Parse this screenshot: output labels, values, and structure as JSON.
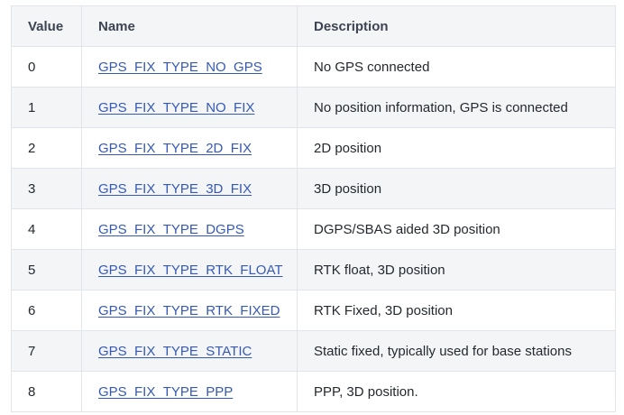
{
  "table": {
    "headers": {
      "value": "Value",
      "name": "Name",
      "description": "Description"
    },
    "rows": [
      {
        "value": "0",
        "name": "GPS_FIX_TYPE_NO_GPS",
        "description": "No GPS connected"
      },
      {
        "value": "1",
        "name": "GPS_FIX_TYPE_NO_FIX",
        "description": "No position information, GPS is connected"
      },
      {
        "value": "2",
        "name": "GPS_FIX_TYPE_2D_FIX",
        "description": "2D position"
      },
      {
        "value": "3",
        "name": "GPS_FIX_TYPE_3D_FIX",
        "description": "3D position"
      },
      {
        "value": "4",
        "name": "GPS_FIX_TYPE_DGPS",
        "description": "DGPS/SBAS aided 3D position"
      },
      {
        "value": "5",
        "name": "GPS_FIX_TYPE_RTK_FLOAT",
        "description": "RTK float, 3D position"
      },
      {
        "value": "6",
        "name": "GPS_FIX_TYPE_RTK_FIXED",
        "description": "RTK Fixed, 3D position"
      },
      {
        "value": "7",
        "name": "GPS_FIX_TYPE_STATIC",
        "description": "Static fixed, typically used for base stations"
      },
      {
        "value": "8",
        "name": "GPS_FIX_TYPE_PPP",
        "description": "PPP, 3D position."
      }
    ]
  },
  "colors": {
    "link": "#3559b5",
    "header_bg": "#f4f5f7",
    "border": "#e1e4e8"
  }
}
